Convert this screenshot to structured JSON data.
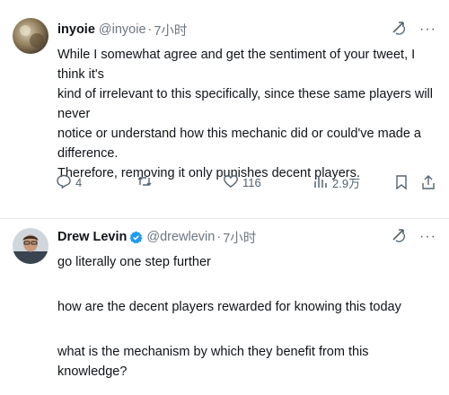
{
  "tweets": [
    {
      "author": {
        "name": "inyoie",
        "handle": "@inyoie",
        "verified": false
      },
      "separator": "·",
      "time": "7小时",
      "text_lines": [
        "While I somewhat agree and get the sentiment of your tweet, I think it's",
        "kind of irrelevant to this specifically, since these same players will never",
        "notice or understand how this mechanic did or could've made a difference.",
        "Therefore, removing it only punishes decent players."
      ],
      "actions": {
        "replies": "4",
        "retweets": "",
        "likes": "116",
        "views": "2.9万"
      },
      "icons": [
        "grok-icon",
        "more-icon",
        "reply-icon",
        "retweet-icon",
        "like-icon",
        "views-icon",
        "bookmark-icon",
        "share-icon"
      ]
    },
    {
      "author": {
        "name": "Drew Levin",
        "handle": "@drewlevin",
        "verified": true
      },
      "separator": "·",
      "time": "7小时",
      "text_lines": [
        "go literally one step further",
        "",
        "how are the decent players rewarded for knowing this today",
        "",
        "what is the mechanism by which they benefit from this knowledge?"
      ],
      "icons": [
        "grok-icon",
        "more-icon",
        "verified-icon"
      ]
    }
  ],
  "colors": {
    "text": "#0f1419",
    "muted": "#536471",
    "verified": "#1d9bf0",
    "divider": "#e6e9ec"
  }
}
